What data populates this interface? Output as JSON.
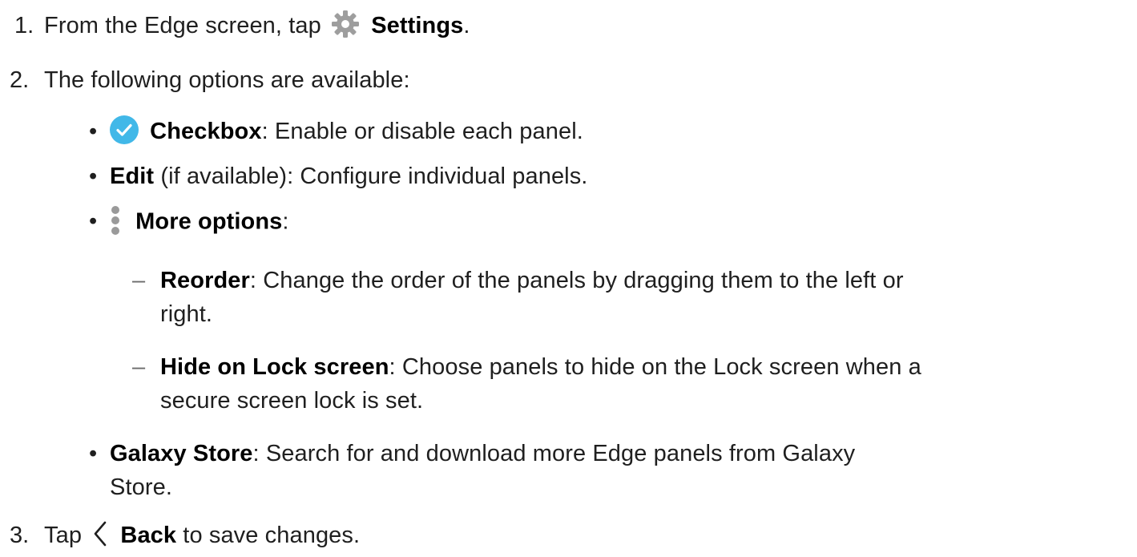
{
  "colors": {
    "text": "#1f1f1f",
    "bold_text": "#000000",
    "gear_icon": "#9e9e9e",
    "checkbox_icon": "#41b8e8",
    "dots_icon": "#9a9a9a",
    "dash": "#6b6b6b"
  },
  "steps": [
    {
      "number": "1.",
      "before": "From the Edge screen, tap",
      "icon": "gear-icon",
      "bold": "Settings",
      "after": "."
    },
    {
      "number": "2.",
      "text": "The following options are available:",
      "options": [
        {
          "icon": "checkbox-icon",
          "bold": "Checkbox",
          "text": ": Enable or disable each panel."
        },
        {
          "bold": "Edit",
          "text": " (if available): Configure individual panels."
        },
        {
          "icon": "more-options-icon",
          "bold": "More options",
          "text": ":",
          "sub_options": [
            {
              "bold": "Reorder",
              "text_line1": ": Change the order of the panels by dragging them to the left or",
              "text_line2": "right."
            },
            {
              "bold": "Hide on Lock screen",
              "text_line1": ": Choose panels to hide on the Lock screen when a",
              "text_line2": "secure screen lock is set."
            }
          ]
        },
        {
          "bold": "Galaxy Store",
          "text_line1": ": Search for and download more Edge panels from Galaxy",
          "text_line2": "Store."
        }
      ]
    },
    {
      "number": "3.",
      "before": "Tap",
      "icon": "back-icon",
      "bold": "Back",
      "after": " to save changes."
    }
  ],
  "bullet_char": "•",
  "dash_char": "–"
}
